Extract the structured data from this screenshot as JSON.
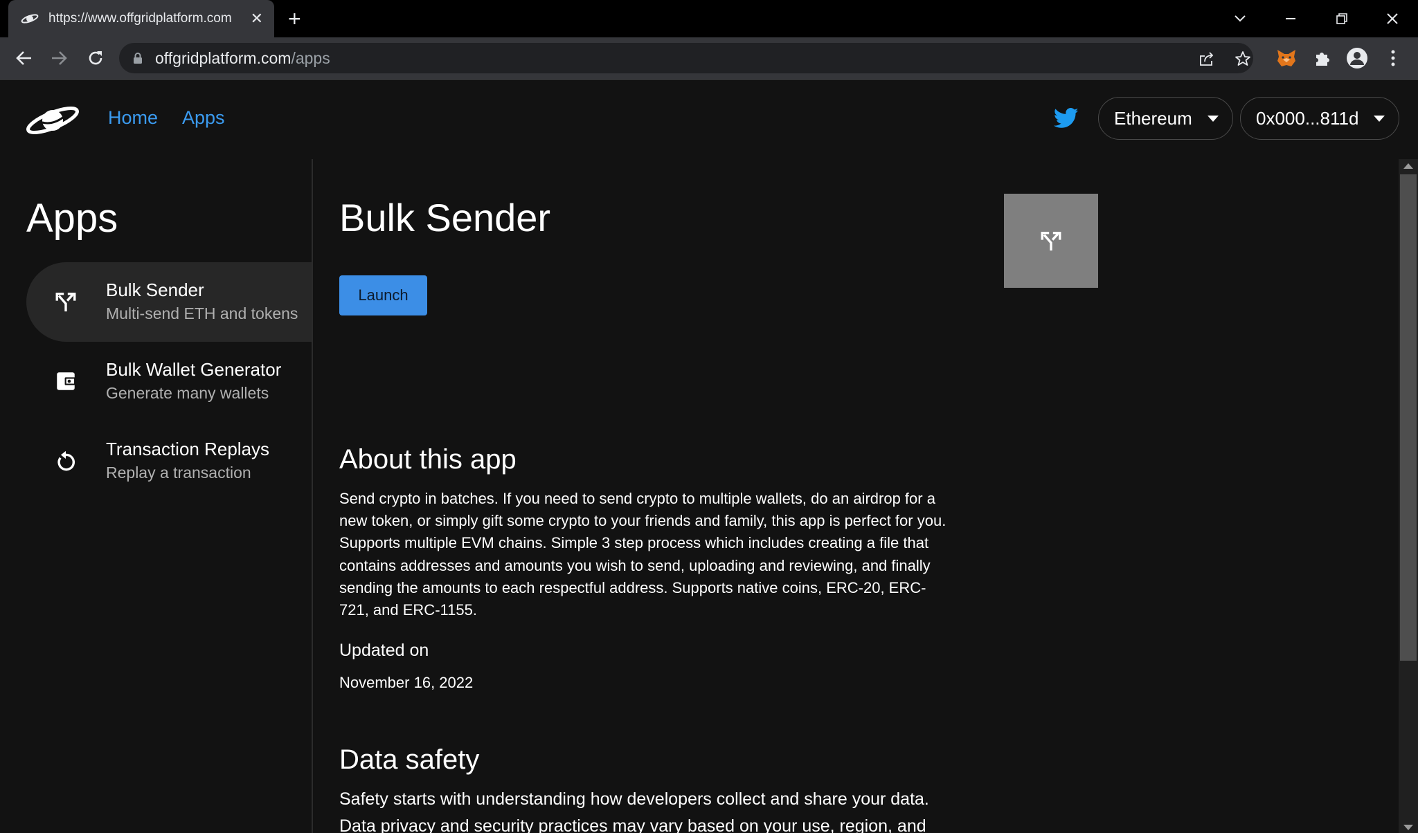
{
  "browser": {
    "tab_title": "https://www.offgridplatform.com",
    "url_host": "offgridplatform.com",
    "url_path": "/apps"
  },
  "header": {
    "nav": [
      "Home",
      "Apps"
    ],
    "network": "Ethereum",
    "wallet": "0x000...811d"
  },
  "sidebar": {
    "title": "Apps",
    "items": [
      {
        "label": "Bulk Sender",
        "sub": "Multi-send ETH and tokens",
        "icon": "fork-arrows-icon"
      },
      {
        "label": "Bulk Wallet Generator",
        "sub": "Generate many wallets",
        "icon": "wallet-icon"
      },
      {
        "label": "Transaction Replays",
        "sub": "Replay a transaction",
        "icon": "replay-icon"
      }
    ]
  },
  "main": {
    "title": "Bulk Sender",
    "launch": "Launch",
    "about_heading": "About this app",
    "about_body": "Send crypto in batches. If you need to send crypto to multiple wallets, do an airdrop for a new token, or simply gift some crypto to your friends and family, this app is perfect for you. Supports multiple EVM chains. Simple 3 step process which includes creating a file that contains addresses and amounts you wish to send, uploading and reviewing, and finally sending the amounts to each respectful address. Supports native coins, ERC-20, ERC-721, and ERC-1155.",
    "updated_label": "Updated on",
    "updated_date": "November 16, 2022",
    "safety_heading": "Data safety",
    "safety_body": "Safety starts with understanding how developers collect and share your data. Data privacy and security practices may vary based on your use, region, and age. The developer provided this information and may update it over time."
  },
  "colors": {
    "accent": "#3b9bf0",
    "launch_button": "#3c8ee6",
    "page_background": "#121212",
    "sidebar_active": "#272727"
  }
}
